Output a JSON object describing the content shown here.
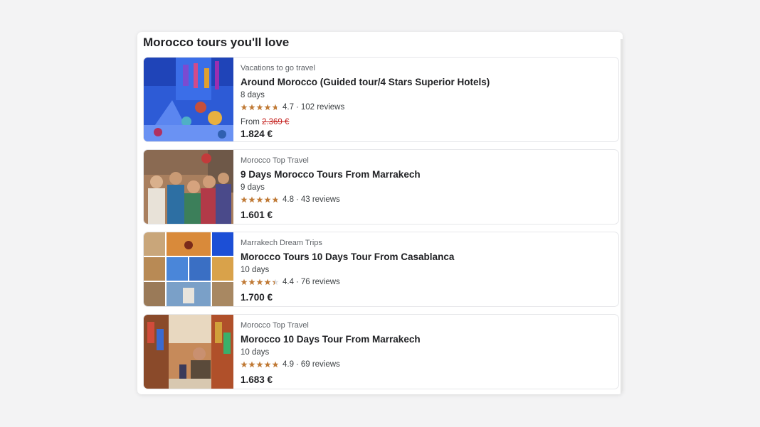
{
  "section": {
    "title": "Morocco tours you'll love"
  },
  "tours": [
    {
      "provider": "Vacations to go travel",
      "title": "Around Morocco (Guided tour/4 Stars Superior Hotels)",
      "duration": "8 days",
      "rating": "4.7",
      "stars": 4.7,
      "reviews": "102 reviews",
      "from_label": "From",
      "old_price": "2.369 €",
      "price": "1.824 €",
      "image_icon": "blue-street-photo"
    },
    {
      "provider": "Morocco Top Travel",
      "title": "9 Days Morocco Tours From Marrakech",
      "duration": "9 days",
      "rating": "4.8",
      "stars": 4.8,
      "reviews": "43 reviews",
      "price": "1.601 €",
      "image_icon": "children-group-photo"
    },
    {
      "provider": "Marrakech Dream Trips",
      "title": "Morocco Tours 10 Days Tour From Casablanca",
      "duration": "10 days",
      "rating": "4.4",
      "stars": 4.4,
      "reviews": "76 reviews",
      "price": "1.700 €",
      "image_icon": "collage-photo"
    },
    {
      "provider": "Morocco Top Travel",
      "title": "Morocco 10 Days Tour From Marrakech",
      "duration": "10 days",
      "rating": "4.9",
      "stars": 4.9,
      "reviews": "69 reviews",
      "price": "1.683 €",
      "image_icon": "market-street-photo"
    }
  ],
  "colors": {
    "star": "#c07a36",
    "old_price": "#c5221f",
    "title": "#202124"
  }
}
